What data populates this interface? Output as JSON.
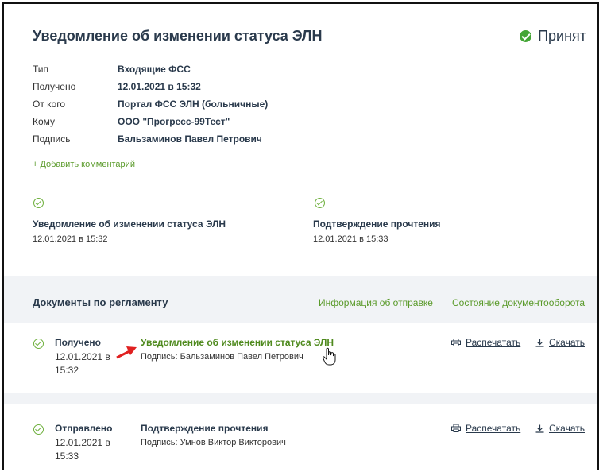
{
  "header": {
    "title": "Уведомление об изменении статуса ЭЛН",
    "status": "Принят"
  },
  "fields": [
    {
      "label": "Тип",
      "value": "Входящие ФСС"
    },
    {
      "label": "Получено",
      "value": "12.01.2021 в 15:32"
    },
    {
      "label": "От кого",
      "value": "Портал ФСС ЭЛН (больничные)"
    },
    {
      "label": "Кому",
      "value": "ООО \"Прогресс-99Тест\""
    },
    {
      "label": "Подпись",
      "value": "Бальзаминов Павел Петрович"
    }
  ],
  "add_comment": "+ Добавить комментарий",
  "timeline": [
    {
      "title": "Уведомление об изменении статуса ЭЛН",
      "date": "12.01.2021 в 15:32"
    },
    {
      "title": "Подтверждение прочтения",
      "date": "12.01.2021 в 15:33"
    }
  ],
  "documents_section": {
    "title": "Документы по регламенту",
    "tabs": [
      "Информация об отправке",
      "Состояние документооборота"
    ]
  },
  "documents": [
    {
      "status": "Получено",
      "date_line1": "12.01.2021 в",
      "date_line2": "15:32",
      "title": "Уведомление об изменении статуса ЭЛН",
      "signature": "Подпись: Бальзаминов Павел Петрович",
      "title_color": "#4f8a1e"
    },
    {
      "status": "Отправлено",
      "date_line1": "12.01.2021 в",
      "date_line2": "15:33",
      "title": "Подтверждение прочтения",
      "signature": "Подпись: Умнов Виктор Викторович",
      "title_color": "#2a3a4c"
    }
  ],
  "actions": {
    "print": "Распечатать",
    "download": "Скачать"
  },
  "colors": {
    "accent": "#5a9a2a",
    "status_ok": "#43a535"
  }
}
